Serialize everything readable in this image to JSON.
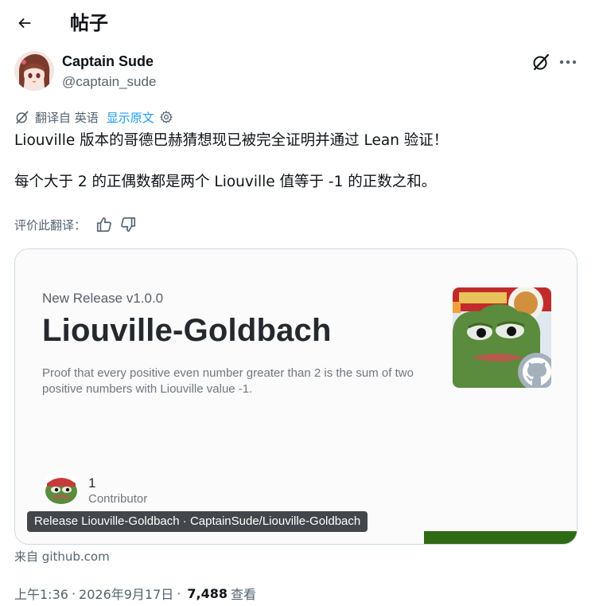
{
  "header": {
    "title": "帖子"
  },
  "tweet": {
    "author_name": "Captain Sude",
    "author_handle": "@captain_sude",
    "translated_from": "翻译自 英语",
    "show_original": "显示原文",
    "text_line1": "Liouville 版本的哥德巴赫猜想现已被完全证明并通过 Lean 验证！",
    "text_line2": "每个大于 2 的正偶数都是两个 Liouville 值等于 -1 的正数之和。",
    "rate_translation": "评价此翻译："
  },
  "card": {
    "release_version": "New Release v1.0.0",
    "repo_title": "Liouville-Goldbach",
    "description": "Proof that every positive even number greater than 2 is the sum of two positive numbers with Liouville value -1.",
    "contributor_count": "1",
    "contributor_label": "Contributor",
    "caption": "Release Liouville-Goldbach · CaptainSude/Liouville-Goldbach",
    "accent_color": "#2f6a15"
  },
  "from": {
    "prefix": "来自",
    "domain": "github.com"
  },
  "meta": {
    "time": "上午1:36",
    "date": "2026年9月17日",
    "separator": "·",
    "views": "7,488",
    "views_label": "查看"
  },
  "icons": [
    "back-arrow-icon",
    "grok-icon",
    "more-icon",
    "translate-icon",
    "gear-icon",
    "thumbs-up-icon",
    "thumbs-down-icon",
    "github-icon"
  ],
  "colors": {
    "link": "#1d9bf0",
    "muted": "#536471",
    "text": "#0f1419"
  }
}
